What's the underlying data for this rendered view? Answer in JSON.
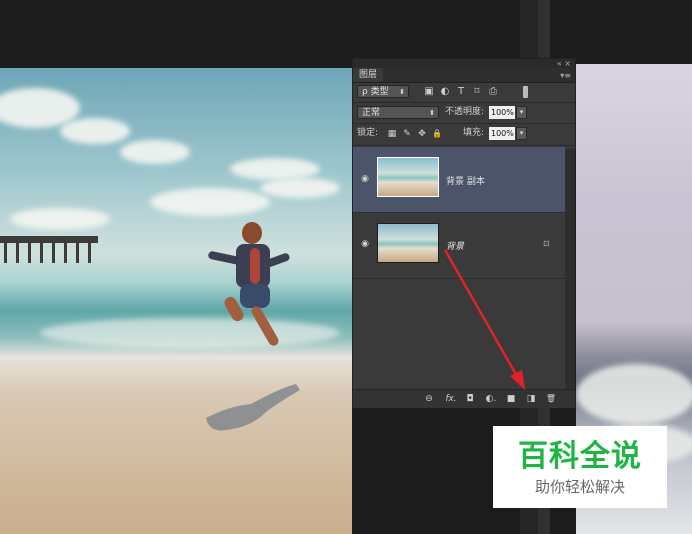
{
  "panel": {
    "top_controls": "«  ×",
    "tab": "图层",
    "tab_menu": "▾≡",
    "filter": {
      "search_glyph": "ρ",
      "value": "类型"
    },
    "filter_icons": [
      "▣",
      "◐",
      "T",
      "⌑",
      "⎙"
    ],
    "blend_mode": "正常",
    "opacity_label": "不透明度:",
    "opacity_value": "100%",
    "lock_label": "锁定:",
    "lock_icons": [
      "▦",
      "✎",
      "✥",
      "🔒"
    ],
    "fill_label": "填充:",
    "fill_value": "100%",
    "layers": [
      {
        "name": "背景 副本",
        "visible": true,
        "selected": true,
        "locked": false
      },
      {
        "name": "背景",
        "visible": true,
        "selected": false,
        "locked": true
      }
    ],
    "bottom_icons": [
      "link-icon",
      "fx-icon",
      "mask-icon",
      "adjustment-icon",
      "folder-icon",
      "new-layer-icon",
      "trash-icon"
    ],
    "bottom_glyphs": [
      "⊖",
      "fx.",
      "◘",
      "◐.",
      "■",
      "◨",
      "🗑"
    ]
  },
  "annotation": {
    "arrow_color": "#e0232b"
  },
  "watermark": {
    "title": "百科全说",
    "subtitle": "助你轻松解决",
    "title_color": "#1fb543"
  },
  "colors": {
    "panel_bg": "#3a3a3a",
    "selected_row": "#4b5469",
    "app_bg": "#1c1c1c"
  }
}
